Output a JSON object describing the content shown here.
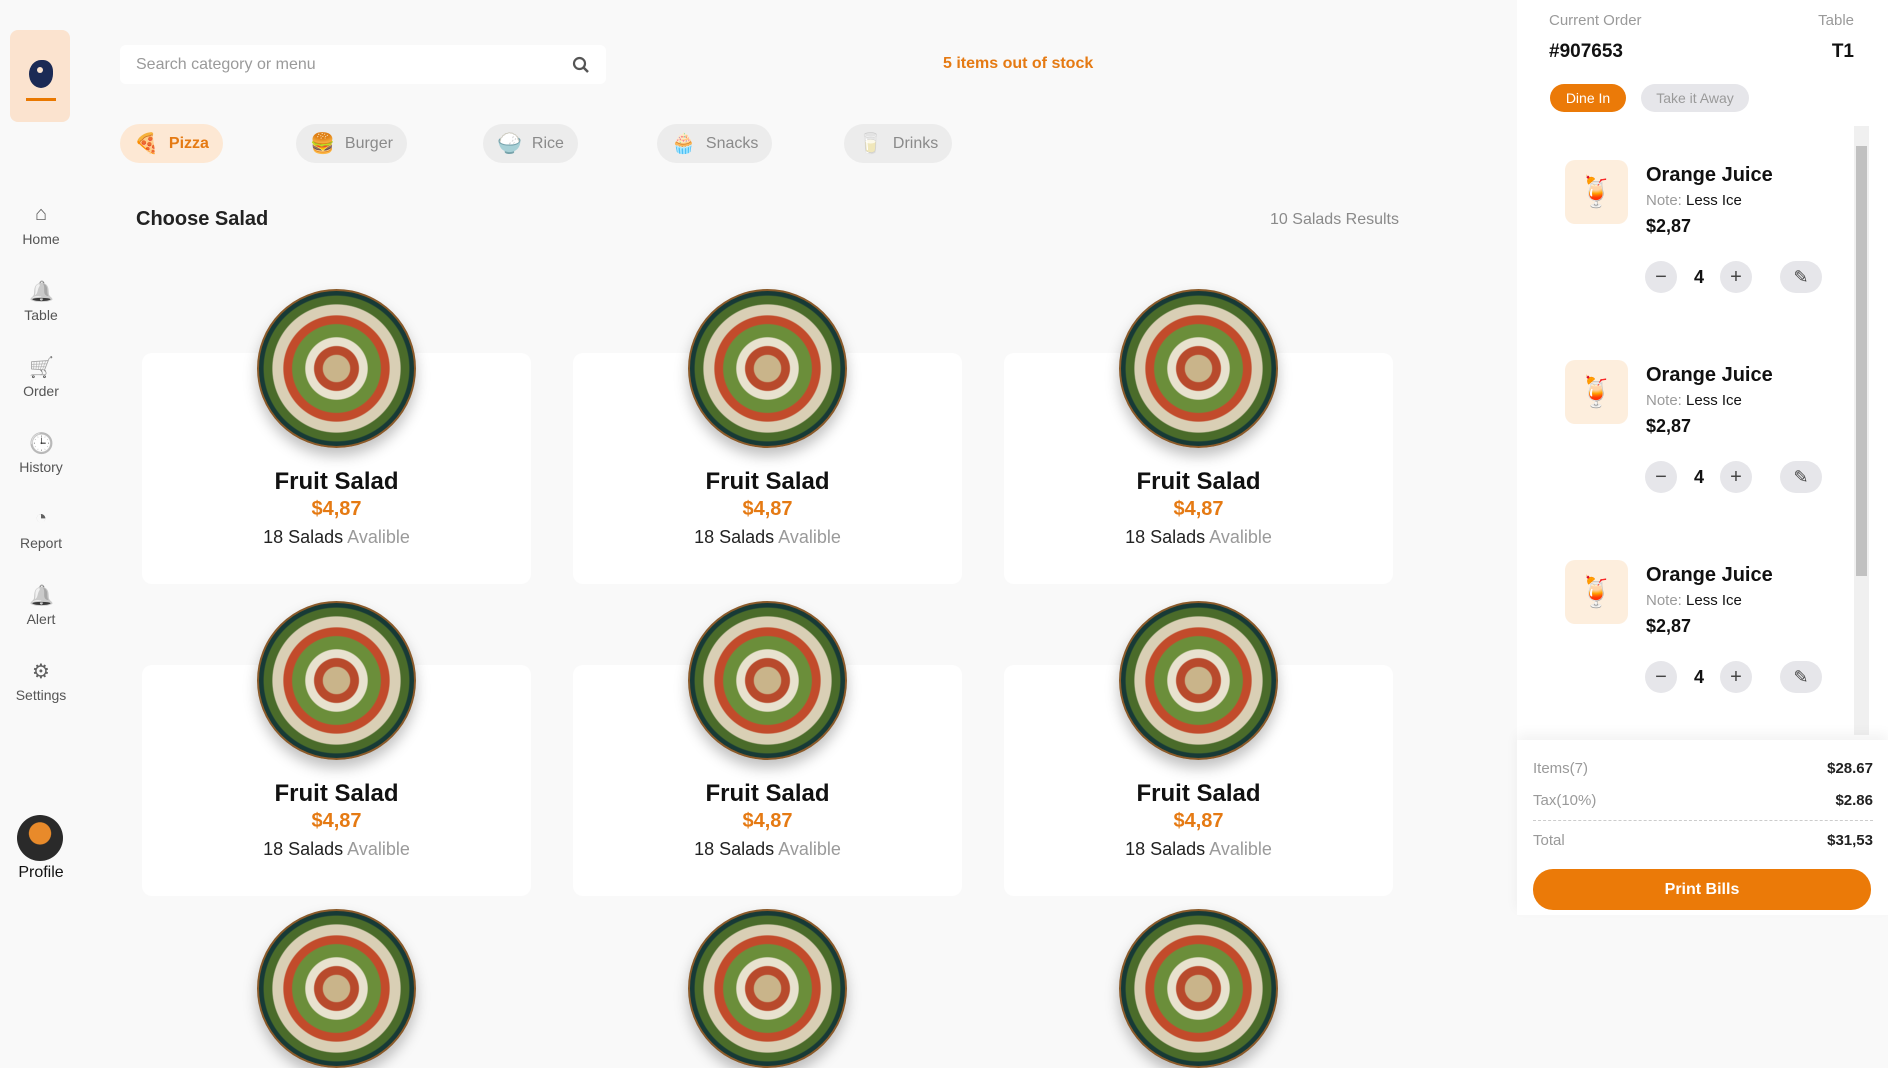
{
  "sidebar": {
    "items": [
      {
        "label": "Home",
        "icon": "home-icon"
      },
      {
        "label": "Table",
        "icon": "bell-icon"
      },
      {
        "label": "Order",
        "icon": "cart-icon"
      },
      {
        "label": "History",
        "icon": "clock-icon"
      },
      {
        "label": "Report",
        "icon": "pie-chart-icon"
      },
      {
        "label": "Alert",
        "icon": "bell-icon"
      },
      {
        "label": "Settings",
        "icon": "gear-icon"
      }
    ],
    "profile": "Profile"
  },
  "search": {
    "placeholder": "Search category or menu"
  },
  "stock_notice": "5 items out of stock",
  "categories": [
    {
      "label": "Pizza",
      "emoji": "🍕"
    },
    {
      "label": "Burger",
      "emoji": "🍔"
    },
    {
      "label": "Rice",
      "emoji": "🍚"
    },
    {
      "label": "Snacks",
      "emoji": "🧁"
    },
    {
      "label": "Drinks",
      "emoji": "🥛"
    }
  ],
  "section": {
    "title": "Choose Salad",
    "results": "10 Salads Results"
  },
  "products": [
    {
      "name": "Fruit Salad",
      "price": "$4,87",
      "count": "18 Salads",
      "avail": "Avalible"
    },
    {
      "name": "Fruit Salad",
      "price": "$4,87",
      "count": "18 Salads",
      "avail": "Avalible"
    },
    {
      "name": "Fruit Salad",
      "price": "$4,87",
      "count": "18 Salads",
      "avail": "Avalible"
    },
    {
      "name": "Fruit Salad",
      "price": "$4,87",
      "count": "18 Salads",
      "avail": "Avalible"
    },
    {
      "name": "Fruit Salad",
      "price": "$4,87",
      "count": "18 Salads",
      "avail": "Avalible"
    },
    {
      "name": "Fruit Salad",
      "price": "$4,87",
      "count": "18 Salads",
      "avail": "Avalible"
    }
  ],
  "order": {
    "label": "Current Order",
    "number": "#907653",
    "table_label": "Table",
    "table": "T1",
    "dine_in": "Dine In",
    "take_away": "Take it Away",
    "items": [
      {
        "name": "Orange Juice",
        "note_label": "Note:",
        "note": "Less Ice",
        "price": "$2,87",
        "qty": "4"
      },
      {
        "name": "Orange Juice",
        "note_label": "Note:",
        "note": "Less Ice",
        "price": "$2,87",
        "qty": "4"
      },
      {
        "name": "Orange Juice",
        "note_label": "Note:",
        "note": "Less Ice",
        "price": "$2,87",
        "qty": "4"
      }
    ]
  },
  "summary": {
    "items_label": "Items(7)",
    "items_value": "$28.67",
    "tax_label": "Tax(10%)",
    "tax_value": "$2.86",
    "total_label": "Total",
    "total_value": "$31,53",
    "print": "Print Bills"
  },
  "colors": {
    "accent": "#eb7a08"
  }
}
